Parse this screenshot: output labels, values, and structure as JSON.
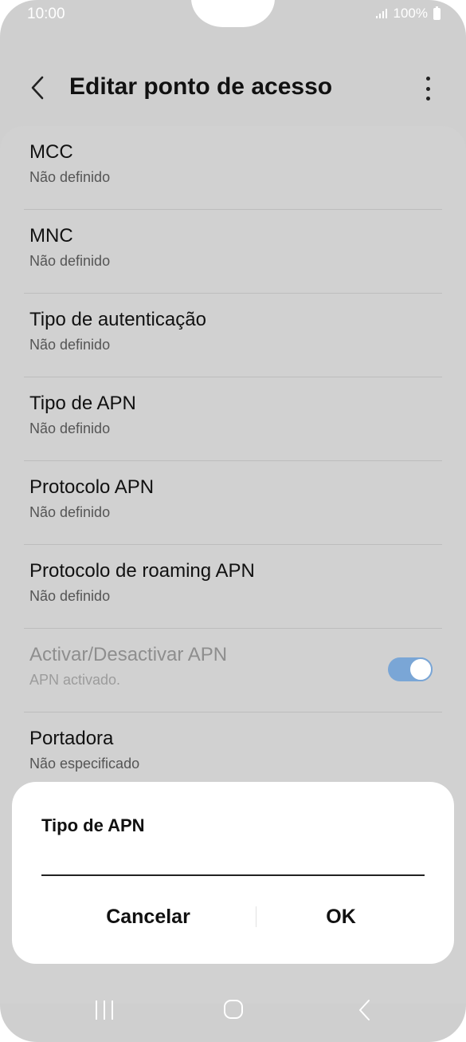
{
  "status_bar": {
    "time": "10:00",
    "battery": "100%"
  },
  "header": {
    "title": "Editar ponto de acesso"
  },
  "settings": [
    {
      "label": "MCC",
      "value": "Não definido"
    },
    {
      "label": "MNC",
      "value": "Não definido"
    },
    {
      "label": "Tipo de autenticação",
      "value": "Não definido"
    },
    {
      "label": "Tipo de APN",
      "value": "Não definido"
    },
    {
      "label": "Protocolo APN",
      "value": "Não definido"
    },
    {
      "label": "Protocolo de roaming APN",
      "value": "Não definido"
    },
    {
      "label": "Activar/Desactivar APN",
      "value": "APN activado.",
      "toggle_on": true
    },
    {
      "label": "Portadora",
      "value": "Não especificado"
    }
  ],
  "dialog": {
    "title": "Tipo de APN",
    "input_value": "",
    "cancel_label": "Cancelar",
    "ok_label": "OK"
  },
  "colors": {
    "toggle_accent": "#7aa6d6",
    "background_dim": "#cfcfcf"
  }
}
